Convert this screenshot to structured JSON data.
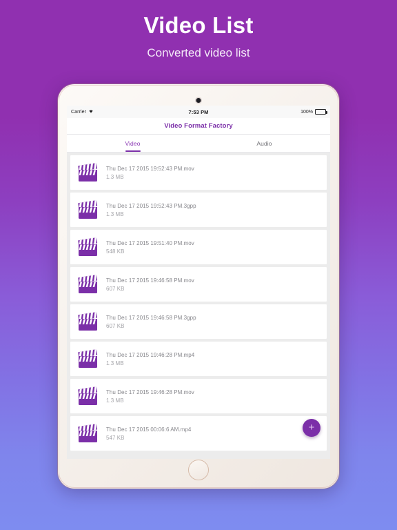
{
  "header": {
    "title": "Video List",
    "subtitle": "Converted video list"
  },
  "colors": {
    "brand_purple": "#7b2fa8",
    "accent_purple": "#8c3ab5",
    "gradient_top": "#9030b0",
    "gradient_bottom": "#7e8cf0",
    "list_background": "#ececec",
    "card_background": "#ffffff"
  },
  "device": {
    "status_bar": {
      "carrier": "Carrier",
      "wifi_icon": "wifi-icon",
      "time": "7:53 PM",
      "battery_percent": "100%",
      "battery_icon": "battery-full-icon"
    },
    "camera_icon": "camera-dot-icon",
    "home_button": "home-button"
  },
  "app": {
    "nav_title": "Video Format Factory",
    "tabs": [
      {
        "label": "Video",
        "active": true
      },
      {
        "label": "Audio",
        "active": false
      }
    ],
    "fab": {
      "icon": "plus-icon",
      "label": "+"
    },
    "list_items": [
      {
        "icon": "clapperboard-icon",
        "name": "Thu Dec 17 2015 19:52:43 PM.mov",
        "size": "1.3 MB"
      },
      {
        "icon": "clapperboard-icon",
        "name": "Thu Dec 17 2015 19:52:43 PM.3gpp",
        "size": "1.3 MB"
      },
      {
        "icon": "clapperboard-icon",
        "name": "Thu Dec 17 2015 19:51:40 PM.mov",
        "size": "548 KB"
      },
      {
        "icon": "clapperboard-icon",
        "name": "Thu Dec 17 2015 19:46:58 PM.mov",
        "size": "607 KB"
      },
      {
        "icon": "clapperboard-icon",
        "name": "Thu Dec 17 2015 19:46:58 PM.3gpp",
        "size": "607 KB"
      },
      {
        "icon": "clapperboard-icon",
        "name": "Thu Dec 17 2015 19:46:28 PM.mp4",
        "size": "1.3 MB"
      },
      {
        "icon": "clapperboard-icon",
        "name": "Thu Dec 17 2015 19:46:28 PM.mov",
        "size": "1.3 MB"
      },
      {
        "icon": "clapperboard-icon",
        "name": "Thu Dec 17 2015 00:06:6 AM.mp4",
        "size": "547 KB"
      }
    ]
  }
}
